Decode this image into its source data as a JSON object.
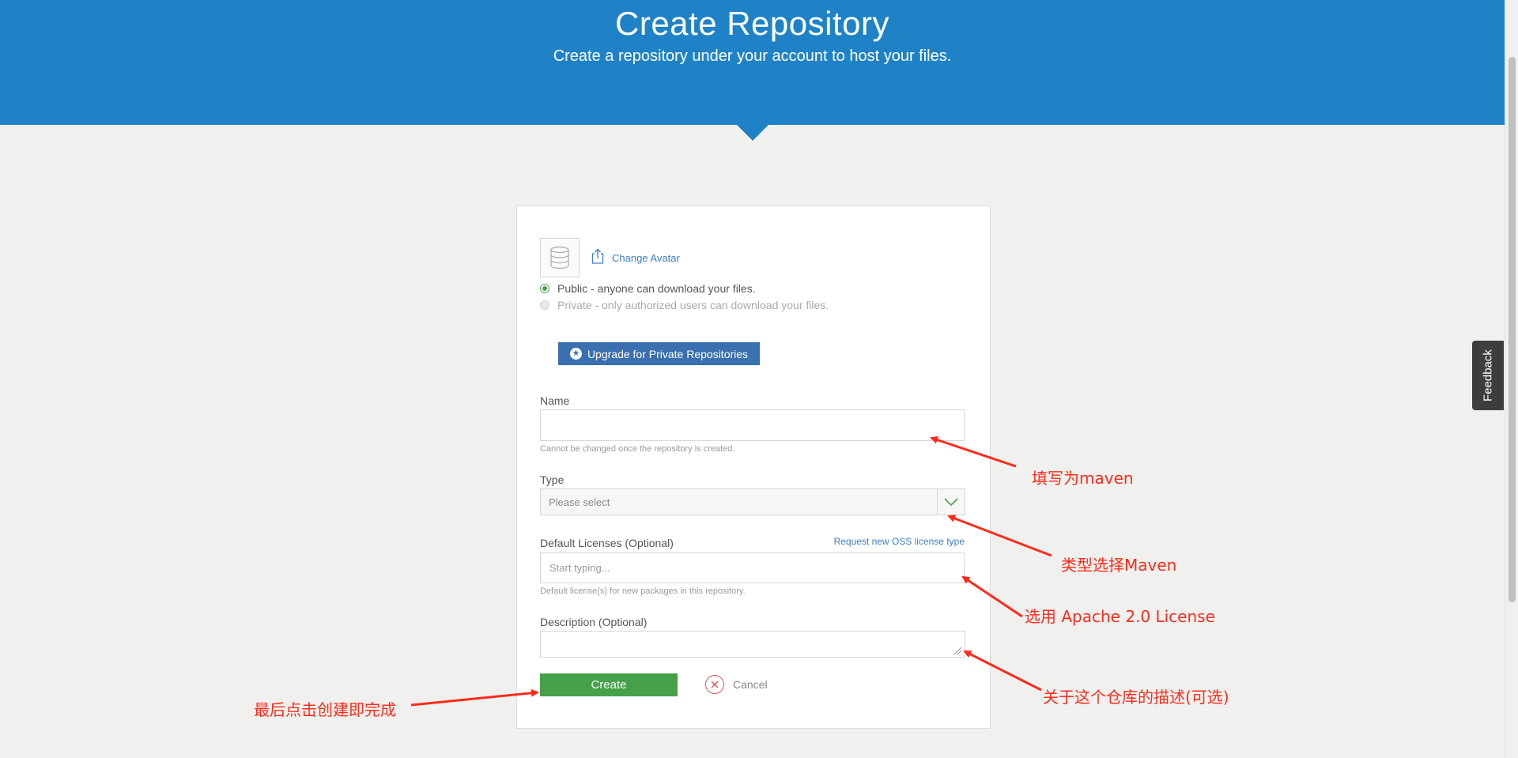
{
  "header": {
    "title": "Create Repository",
    "subtitle": "Create a repository under your account to host your files."
  },
  "avatar": {
    "change_label": "Change Avatar"
  },
  "visibility": {
    "public_label": "Public - anyone can download your files.",
    "private_label": "Private - only authorized users can download your files.",
    "selected": "public",
    "upgrade_label": "Upgrade for Private Repositories"
  },
  "form": {
    "name": {
      "label": "Name",
      "value": "",
      "hint": "Cannot be changed once the repository is created."
    },
    "type": {
      "label": "Type",
      "selected_text": "Please select"
    },
    "licenses": {
      "label": "Default Licenses (Optional)",
      "request_link": "Request new OSS license type",
      "placeholder": "Start typing...",
      "hint": "Default license(s) for new packages in this repository."
    },
    "description": {
      "label": "Description (Optional)",
      "value": ""
    },
    "create_label": "Create",
    "cancel_label": "Cancel"
  },
  "feedback_label": "Feedback",
  "annotations": {
    "name": "填写为maven",
    "type": "类型选择Maven",
    "license": "选用 Apache 2.0 License",
    "description": "关于这个仓库的描述(可选)",
    "create": "最后点击创建即完成"
  },
  "colors": {
    "header_bg": "#1f82c7",
    "page_bg": "#f0f1ef",
    "upgrade_bg": "#3a6fb0",
    "create_bg": "#45a049",
    "link": "#3b7fc4",
    "annotation": "#ff2a1a"
  }
}
